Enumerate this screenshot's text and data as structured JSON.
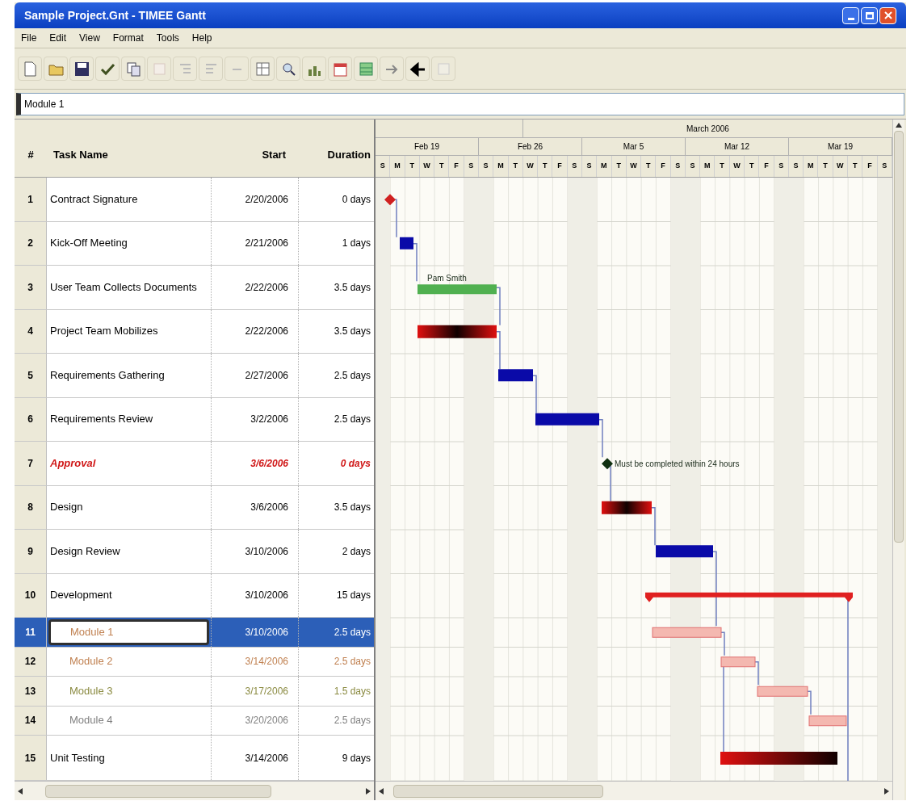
{
  "window": {
    "title": "Sample Project.Gnt - TIMEE Gantt"
  },
  "menu": [
    "File",
    "Edit",
    "View",
    "Format",
    "Tools",
    "Help"
  ],
  "entry_bar": {
    "value": "Module 1"
  },
  "table": {
    "columns": [
      "#",
      "Task Name",
      "Start",
      "Duration"
    ],
    "rows": [
      {
        "id": "1",
        "name": "Contract Signature",
        "start": "2/20/2006",
        "duration": "0 days",
        "color": "#000000",
        "emphasis": false,
        "selected": false,
        "kind": "milestone"
      },
      {
        "id": "2",
        "name": "Kick-Off Meeting",
        "start": "2/21/2006",
        "duration": "1 days",
        "color": "#000000",
        "emphasis": false,
        "selected": false,
        "kind": "task"
      },
      {
        "id": "3",
        "name": "User Team Collects Documents",
        "start": "2/22/2006",
        "duration": "3.5 days",
        "color": "#000000",
        "emphasis": false,
        "selected": false,
        "kind": "resource",
        "bar_label": "Pam Smith"
      },
      {
        "id": "4",
        "name": "Project Team Mobilizes",
        "start": "2/22/2006",
        "duration": "3.5 days",
        "color": "#000000",
        "emphasis": false,
        "selected": false,
        "kind": "critical"
      },
      {
        "id": "5",
        "name": "Requirements Gathering",
        "start": "2/27/2006",
        "duration": "2.5 days",
        "color": "#000000",
        "emphasis": false,
        "selected": false,
        "kind": "task"
      },
      {
        "id": "6",
        "name": "Requirements Review",
        "start": "3/2/2006",
        "duration": "2.5 days",
        "color": "#000000",
        "emphasis": false,
        "selected": false,
        "kind": "task"
      },
      {
        "id": "7",
        "name": "Approval",
        "start": "3/6/2006",
        "duration": "0 days",
        "color": "#d01818",
        "emphasis": true,
        "selected": false,
        "kind": "milestone",
        "bar_label": "Must be completed within 24 hours"
      },
      {
        "id": "8",
        "name": "Design",
        "start": "3/6/2006",
        "duration": "3.5 days",
        "color": "#000000",
        "emphasis": false,
        "selected": false,
        "kind": "critical"
      },
      {
        "id": "9",
        "name": "Design Review",
        "start": "3/10/2006",
        "duration": "2 days",
        "color": "#000000",
        "emphasis": false,
        "selected": false,
        "kind": "task"
      },
      {
        "id": "10",
        "name": "Development",
        "start": "3/10/2006",
        "duration": "15 days",
        "color": "#000000",
        "emphasis": false,
        "selected": false,
        "kind": "summary",
        "children": [
          {
            "id": "11",
            "name": "Module 1",
            "start": "3/10/2006",
            "duration": "2.5 days",
            "color": "#c08050",
            "emphasis": false,
            "selected": true,
            "kind": "subtask"
          },
          {
            "id": "12",
            "name": "Module 2",
            "start": "3/14/2006",
            "duration": "2.5 days",
            "color": "#c08050",
            "emphasis": false,
            "selected": false,
            "kind": "subtask"
          },
          {
            "id": "13",
            "name": "Module 3",
            "start": "3/17/2006",
            "duration": "1.5 days",
            "color": "#8a8a40",
            "emphasis": false,
            "selected": false,
            "kind": "subtask"
          },
          {
            "id": "14",
            "name": "Module 4",
            "start": "3/20/2006",
            "duration": "2.5 days",
            "color": "#808080",
            "emphasis": false,
            "selected": false,
            "kind": "subtask"
          }
        ]
      },
      {
        "id": "15",
        "name": "Unit Testing",
        "start": "3/14/2006",
        "duration": "9 days",
        "color": "#000000",
        "emphasis": false,
        "selected": false,
        "kind": "critical"
      }
    ]
  },
  "timeline": {
    "months": [
      {
        "label": "March 2006"
      }
    ],
    "weeks": [
      "Feb 19",
      "Feb 26",
      "Mar 5",
      "Mar 12",
      "Mar 19"
    ],
    "days": [
      "S",
      "M",
      "T",
      "W",
      "T",
      "F",
      "S",
      "S",
      "M",
      "T",
      "W",
      "T",
      "F",
      "S",
      "S",
      "M",
      "T",
      "W",
      "T",
      "F",
      "S",
      "S",
      "M",
      "T",
      "W",
      "T",
      "F",
      "S",
      "S",
      "M",
      "T",
      "W",
      "T",
      "F",
      "S"
    ]
  }
}
